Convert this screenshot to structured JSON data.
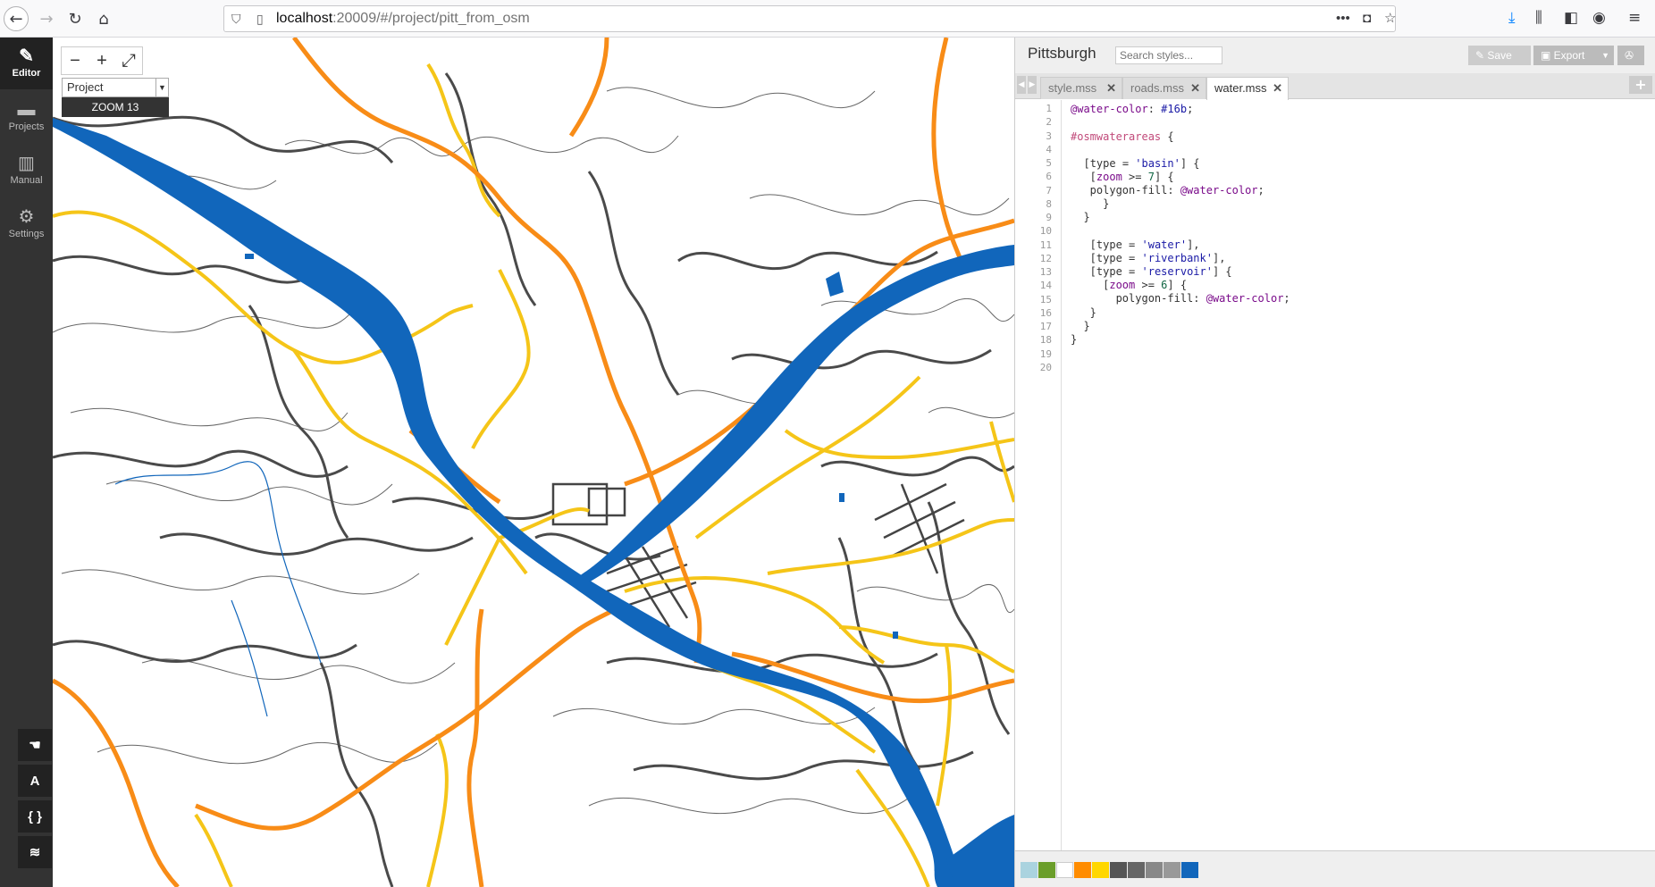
{
  "browser": {
    "url_host": "localhost",
    "url_path": ":20009/#/project/pitt_from_osm"
  },
  "sidebar": {
    "items": [
      {
        "label": "Editor",
        "icon": "pencil-icon"
      },
      {
        "label": "Projects",
        "icon": "folder-icon"
      },
      {
        "label": "Manual",
        "icon": "book-icon"
      },
      {
        "label": "Settings",
        "icon": "gear-icon"
      }
    ],
    "tools": [
      "hand",
      "A",
      "{ }",
      "layers"
    ]
  },
  "map": {
    "zoom_minus": "−",
    "zoom_plus": "+",
    "fullscreen": "⤢",
    "layer_select": "Project",
    "zoom_label": "ZOOM 13"
  },
  "editor": {
    "project_name": "Pittsburgh",
    "search_placeholder": "Search styles...",
    "save_label": "Save",
    "export_label": "Export",
    "tabs": [
      {
        "label": "style.mss",
        "active": false
      },
      {
        "label": "roads.mss",
        "active": false
      },
      {
        "label": "water.mss",
        "active": true
      }
    ],
    "line_numbers": [
      "1",
      "2",
      "3",
      "4",
      "5",
      "6",
      "7",
      "8",
      "9",
      "10",
      "11",
      "12",
      "13",
      "14",
      "15",
      "16",
      "17",
      "18",
      "19",
      "20"
    ]
  },
  "palette": {
    "colors": [
      "#aad3df",
      "#6b9e2b",
      "#ffffff",
      "#ff8c00",
      "#ffd700",
      "#555555",
      "#666666",
      "#888888",
      "#999999",
      "#1166bb"
    ]
  },
  "theme": {
    "water": "#16b",
    "highway": "#f88c17",
    "primary": "#f5c518",
    "road": "#555555"
  }
}
